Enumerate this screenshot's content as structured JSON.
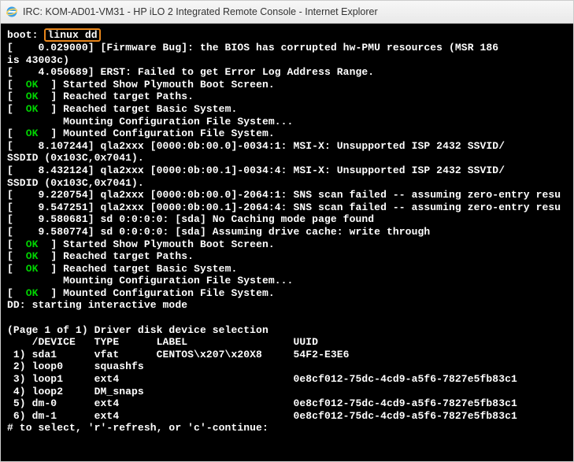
{
  "window": {
    "title": "IRC: KOM-AD01-VM31 - HP iLO 2 Integrated Remote Console - Internet Explorer"
  },
  "boot": {
    "label": "boot: ",
    "cmd": "linux dd"
  },
  "lines": [
    "[    0.029000] [Firmware Bug]: the BIOS has corrupted hw-PMU resources (MSR 186",
    "is 43003c)",
    "[    4.050689] ERST: Failed to get Error Log Address Range."
  ],
  "ok1": [
    "Started Show Plymouth Boot Screen.",
    "Reached target Paths.",
    "Reached target Basic System."
  ],
  "mount1": "         Mounting Configuration File System...",
  "ok2": "Mounted Configuration File System.",
  "qla": [
    "[    8.107244] qla2xxx [0000:0b:00.0]-0034:1: MSI-X: Unsupported ISP 2432 SSVID/",
    "SSDID (0x103C,0x7041).",
    "[    8.432124] qla2xxx [0000:0b:00.1]-0034:4: MSI-X: Unsupported ISP 2432 SSVID/",
    "SSDID (0x103C,0x7041).",
    "[    9.220754] qla2xxx [0000:0b:00.0]-2064:1: SNS scan failed -- assuming zero-entry resu",
    "[    9.547251] qla2xxx [0000:0b:00.1]-2064:4: SNS scan failed -- assuming zero-entry resu",
    "[    9.580681] sd 0:0:0:0: [sda] No Caching mode page found",
    "[    9.580774] sd 0:0:0:0: [sda] Assuming drive cache: write through"
  ],
  "ok3": [
    "Started Show Plymouth Boot Screen.",
    "Reached target Paths.",
    "Reached target Basic System."
  ],
  "mount2": "         Mounting Configuration File System...",
  "ok4": "Mounted Configuration File System.",
  "dd": "DD: starting interactive mode",
  "page": "(Page 1 of 1) Driver disk device selection",
  "hdr": "    /DEVICE   TYPE      LABEL                 UUID",
  "rows": [
    " 1) sda1      vfat      CENTOS\\x207\\x20X8     54F2-E3E6",
    " 2) loop0     squashfs",
    " 3) loop1     ext4                            0e8cf012-75dc-4cd9-a5f6-7827e5fb83c1",
    " 4) loop2     DM_snaps",
    " 5) dm-0      ext4                            0e8cf012-75dc-4cd9-a5f6-7827e5fb83c1",
    " 6) dm-1      ext4                            0e8cf012-75dc-4cd9-a5f6-7827e5fb83c1"
  ],
  "prompt": "# to select, 'r'-refresh, or 'c'-continue:"
}
